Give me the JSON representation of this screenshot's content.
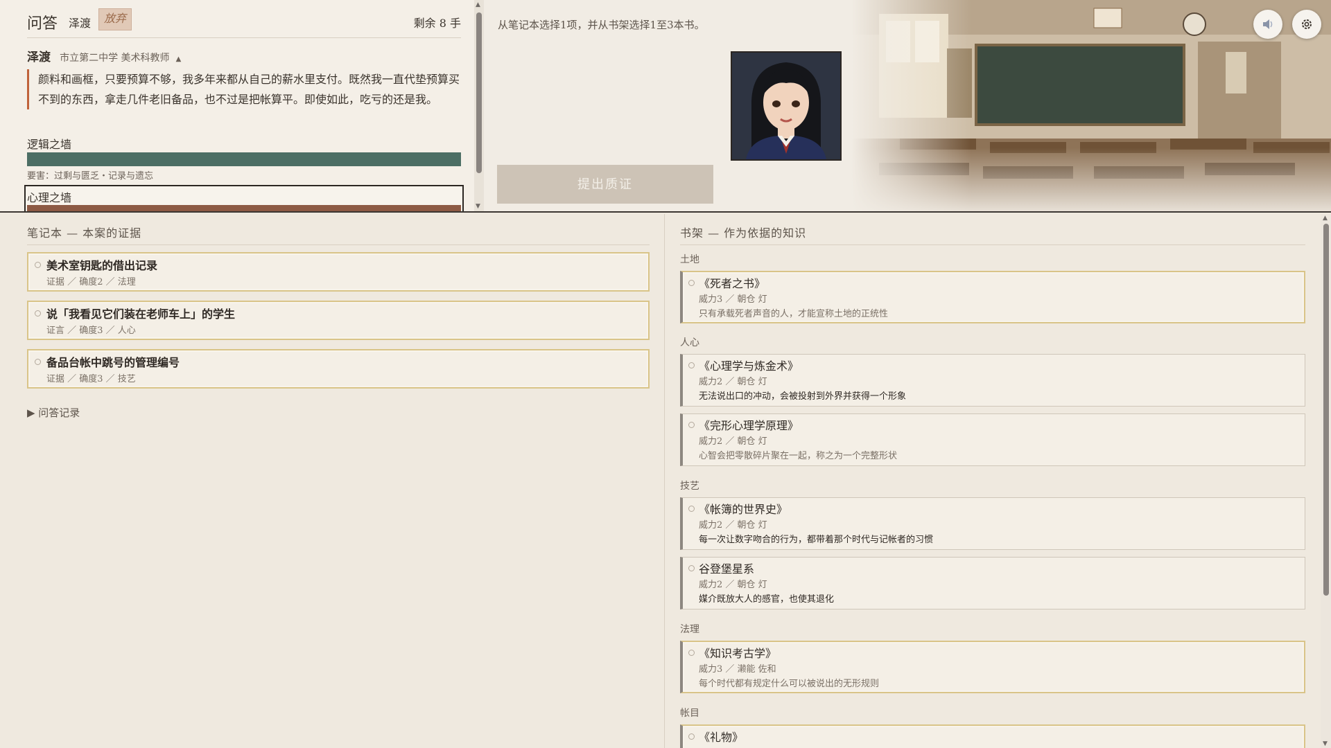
{
  "qa": {
    "title": "问答",
    "opponent": "泽渡",
    "give_up": "放弃",
    "remaining": "剩余 8 手",
    "speaker_name": "泽渡",
    "speaker_role": "市立第二中学 美术科教师",
    "speaker_toggle": "▲",
    "speech": "颜料和画框，只要预算不够，我多年来都从自己的薪水里支付。既然我一直代垫预算买不到的东西，拿走几件老旧备品，也不过是把帐算平。即使如此，吃亏的还是我。",
    "walls": [
      {
        "label": "逻辑之墙",
        "note": "要害：过剩与匮乏・记录与遗忘",
        "color": "#4c6e64",
        "level": 1.0
      },
      {
        "label": "心理之墙",
        "color": "#8d5a44",
        "level": 1.0
      }
    ]
  },
  "center": {
    "instruction": "从笔记本选择1项，并从书架选择1至3本书。",
    "submit_label": "提出质证"
  },
  "icons": {
    "sound": "speaker-icon",
    "settings": "gear-icon"
  },
  "notebook": {
    "title": "笔记本 — 本案的证据",
    "items": [
      {
        "title": "美术室钥匙的借出记录",
        "meta": "证据 ／ 确度2 ／ 法理"
      },
      {
        "title": "说「我看见它们装在老师车上」的学生",
        "meta": "证言 ／ 确度3 ／ 人心"
      },
      {
        "title": "备品台帐中跳号的管理编号",
        "meta": "证据 ／ 确度3 ／ 技艺"
      }
    ],
    "history_label": "▶ 问答记录"
  },
  "bookshelf": {
    "title": "书架 — 作为依据的知识",
    "categories": [
      {
        "label": "土地",
        "books": [
          {
            "title": "《死者之书》",
            "meta": "威力3 ／ 朝仓 灯",
            "desc": "只有承载死者声音的人，才能宣称土地的正统性"
          }
        ]
      },
      {
        "label": "人心",
        "books": [
          {
            "title": "《心理学与炼金术》",
            "meta": "威力2 ／ 朝仓 灯",
            "desc": "无法说出口的冲动，会被投射到外界并获得一个形象"
          },
          {
            "title": "《完形心理学原理》",
            "meta": "威力2 ／ 朝仓 灯",
            "desc": "心智会把零散碎片聚在一起，称之为一个完整形状"
          }
        ]
      },
      {
        "label": "技艺",
        "books": [
          {
            "title": "《帐簿的世界史》",
            "meta": "威力2 ／ 朝仓 灯",
            "desc": "每一次让数字吻合的行为，都带着那个时代与记帐者的习惯"
          },
          {
            "title": "谷登堡星系",
            "meta": "威力2 ／ 朝仓 灯",
            "desc": "媒介既放大人的感官，也使其退化"
          }
        ]
      },
      {
        "label": "法理",
        "books": [
          {
            "title": "《知识考古学》",
            "meta": "威力3 ／ 濑能 佐和",
            "desc": "每个时代都有规定什么可以被说出的无形规则"
          }
        ]
      },
      {
        "label": "帐目",
        "books": [
          {
            "title": "《礼物》",
            "meta": "",
            "desc": ""
          }
        ]
      }
    ]
  }
}
